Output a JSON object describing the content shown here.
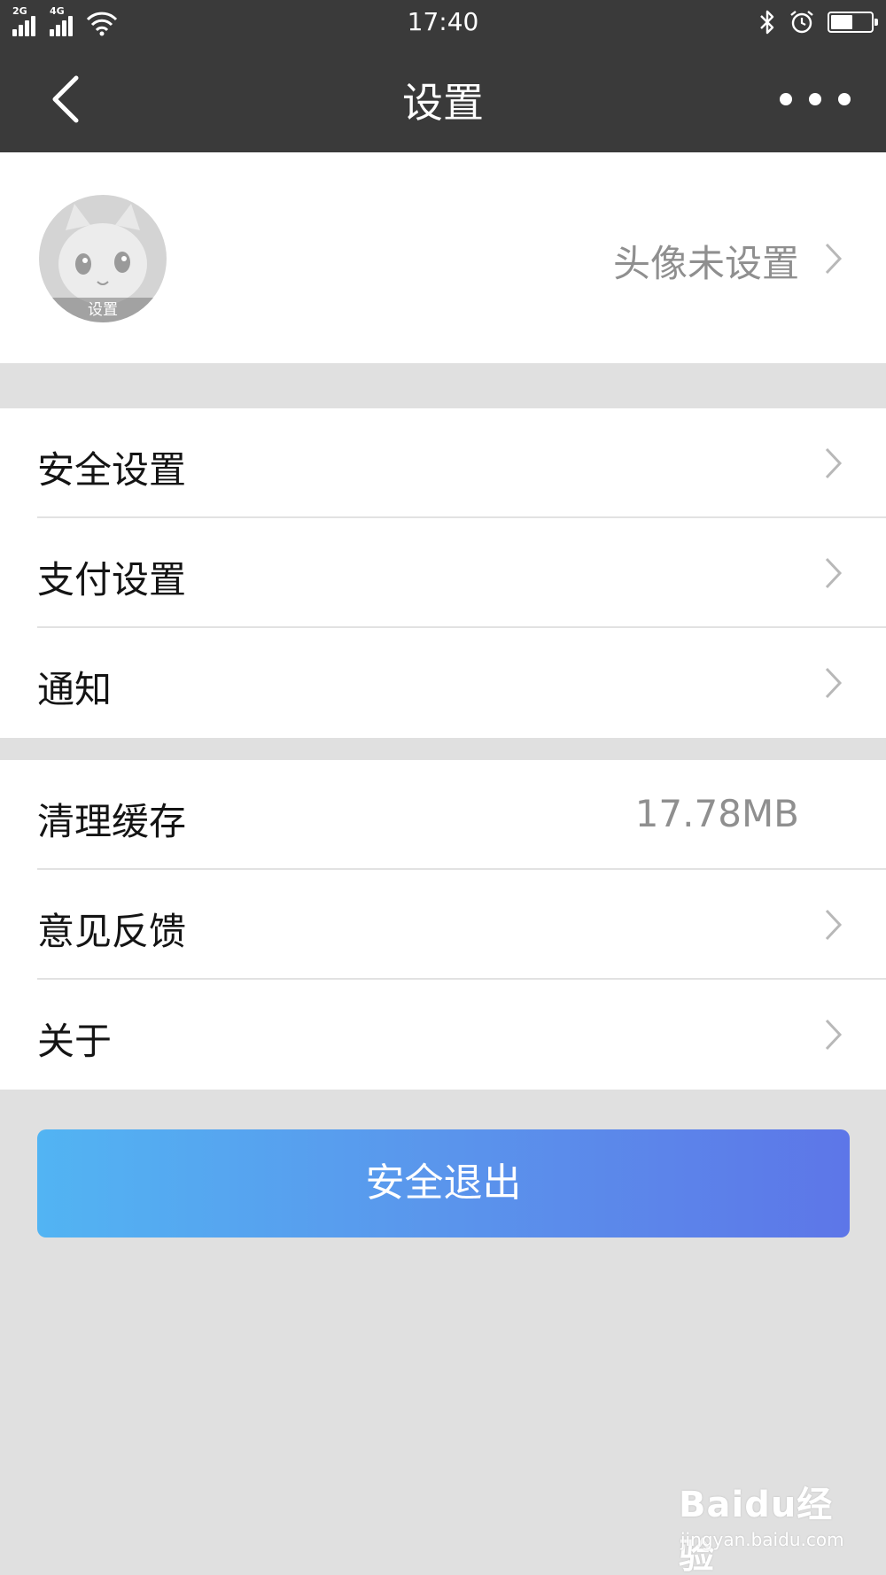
{
  "status_bar": {
    "signal_1_label": "2G",
    "signal_2_label": "4G",
    "time": "17:40",
    "battery_level_percent": 55,
    "icons": [
      "signal-icon",
      "wifi-icon",
      "bluetooth-icon",
      "alarm-icon",
      "battery-icon"
    ]
  },
  "nav": {
    "title": "设置",
    "back_icon": "chevron-left-icon",
    "more_icon": "more-dots-icon"
  },
  "profile": {
    "avatar_caption": "设置",
    "avatar_status": "头像未设置"
  },
  "group1": [
    {
      "label": "安全设置"
    },
    {
      "label": "支付设置"
    },
    {
      "label": "通知"
    }
  ],
  "group2": [
    {
      "label": "清理缓存",
      "value": "17.78MB"
    },
    {
      "label": "意见反馈"
    },
    {
      "label": "关于"
    }
  ],
  "logout_label": "安全退出",
  "watermark": {
    "brand": "Baidu经验",
    "url": "jingyan.baidu.com"
  },
  "colors": {
    "header_bg": "#3a3a3a",
    "page_bg": "#e0e0e0",
    "button_gradient_start": "#52b4f3",
    "button_gradient_end": "#5d76e8",
    "secondary_text": "#8f8f8f"
  }
}
